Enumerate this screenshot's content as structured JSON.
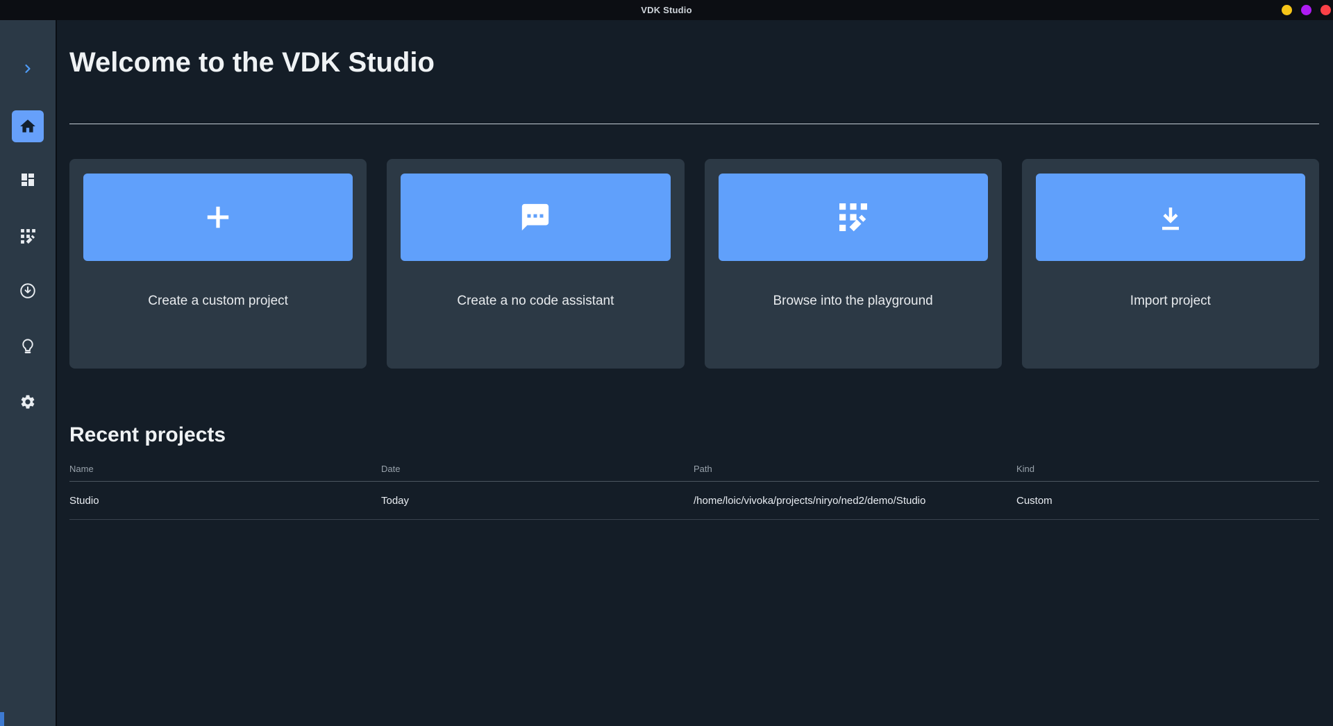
{
  "titlebar": {
    "title": "VDK Studio",
    "buttons": [
      {
        "name": "minimize",
        "color": "#f6c518"
      },
      {
        "name": "maximize",
        "color": "#ae1cf2"
      },
      {
        "name": "close",
        "color": "#fb4147"
      }
    ]
  },
  "sidebar": {
    "items": [
      {
        "id": "expand",
        "icon": "chevron-right-icon",
        "active": false
      },
      {
        "id": "home",
        "icon": "home-icon",
        "active": true
      },
      {
        "id": "projects",
        "icon": "dashboard-icon",
        "active": false
      },
      {
        "id": "playground",
        "icon": "grid-edit-icon",
        "active": false
      },
      {
        "id": "import",
        "icon": "download-circle-icon",
        "active": false
      },
      {
        "id": "ideas",
        "icon": "lightbulb-icon",
        "active": false
      },
      {
        "id": "settings",
        "icon": "gear-icon",
        "active": false
      }
    ]
  },
  "main": {
    "welcome_title": "Welcome to the VDK Studio",
    "action_cards": [
      {
        "label": "Create a custom project",
        "icon": "plus-icon"
      },
      {
        "label": "Create a no code assistant",
        "icon": "chat-bubble-icon"
      },
      {
        "label": "Browse into the playground",
        "icon": "grid-edit-icon"
      },
      {
        "label": "Import project",
        "icon": "download-icon"
      }
    ],
    "recent_projects": {
      "title": "Recent projects",
      "columns": [
        "Name",
        "Date",
        "Path",
        "Kind"
      ],
      "rows": [
        {
          "name": "Studio",
          "date": "Today",
          "path": "/home/loic/vivoka/projects/niryo/ned2/demo/Studio",
          "kind": "Custom"
        }
      ]
    }
  },
  "colors": {
    "accent_blue": "#60a0fb",
    "titlebar_bg": "#0c0e13",
    "sidebar_bg": "#2b3946",
    "main_bg": "#141d27",
    "card_bg": "#2c3945",
    "resize_grip_blue": "#3e7ad1"
  }
}
